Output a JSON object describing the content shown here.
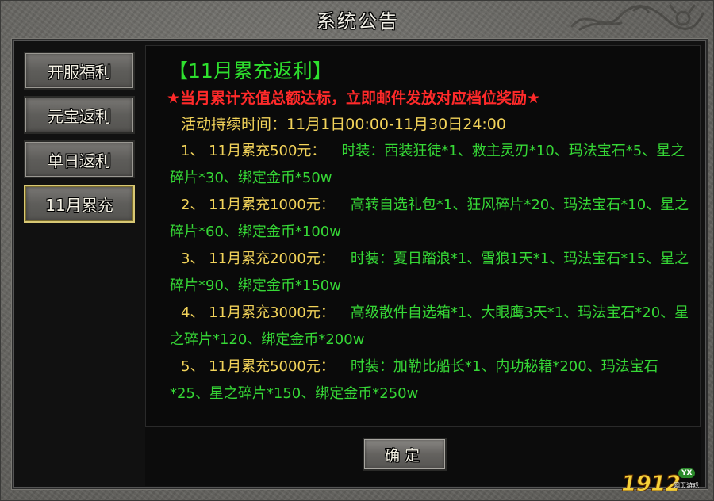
{
  "window": {
    "title": "系统公告"
  },
  "sidebar": {
    "tabs": [
      {
        "label": "开服福利"
      },
      {
        "label": "元宝返利"
      },
      {
        "label": "单日返利"
      },
      {
        "label": "11月累充",
        "active": true
      }
    ]
  },
  "content": {
    "heading": "【11月累充返利】",
    "notice": "★当月累计充值总额达标，立即邮件发放对应档位奖励★",
    "period": "活动持续时间：11月1日00:00-11月30日24:00",
    "tiers": [
      {
        "prefix": "1、 11月累充500元：",
        "rewards": "时装：西装狂徒*1、救主灵刃*10、玛法宝石*5、星之碎片*30、绑定金币*50w"
      },
      {
        "prefix": "2、 11月累充1000元：",
        "rewards": "高转自选礼包*1、狂风碎片*20、玛法宝石*10、星之碎片*60、绑定金币*100w"
      },
      {
        "prefix": "3、 11月累充2000元：",
        "rewards": "时装：夏日踏浪*1、雪狼1天*1、玛法宝石*15、星之碎片*90、绑定金币*150w"
      },
      {
        "prefix": "4、 11月累充3000元：",
        "rewards": "高级散件自选箱*1、大眼鹰3天*1、玛法宝石*20、星之碎片*120、绑定金币*200w"
      },
      {
        "prefix": "5、 11月累充5000元：",
        "rewards": "时装：加勒比船长*1、内功秘籍*200、玛法宝石*25、星之碎片*150、绑定金币*250w"
      }
    ]
  },
  "footer": {
    "confirm_label": "确定"
  },
  "watermark": {
    "digits": "1912",
    "badge": "YX",
    "sub": "网页游戏"
  },
  "colors": {
    "heading": "#2ee02e",
    "notice": "#ff2a2a",
    "period": "#f2d35a",
    "rewards": "#36d836",
    "active_tab_border": "#d8c874"
  }
}
